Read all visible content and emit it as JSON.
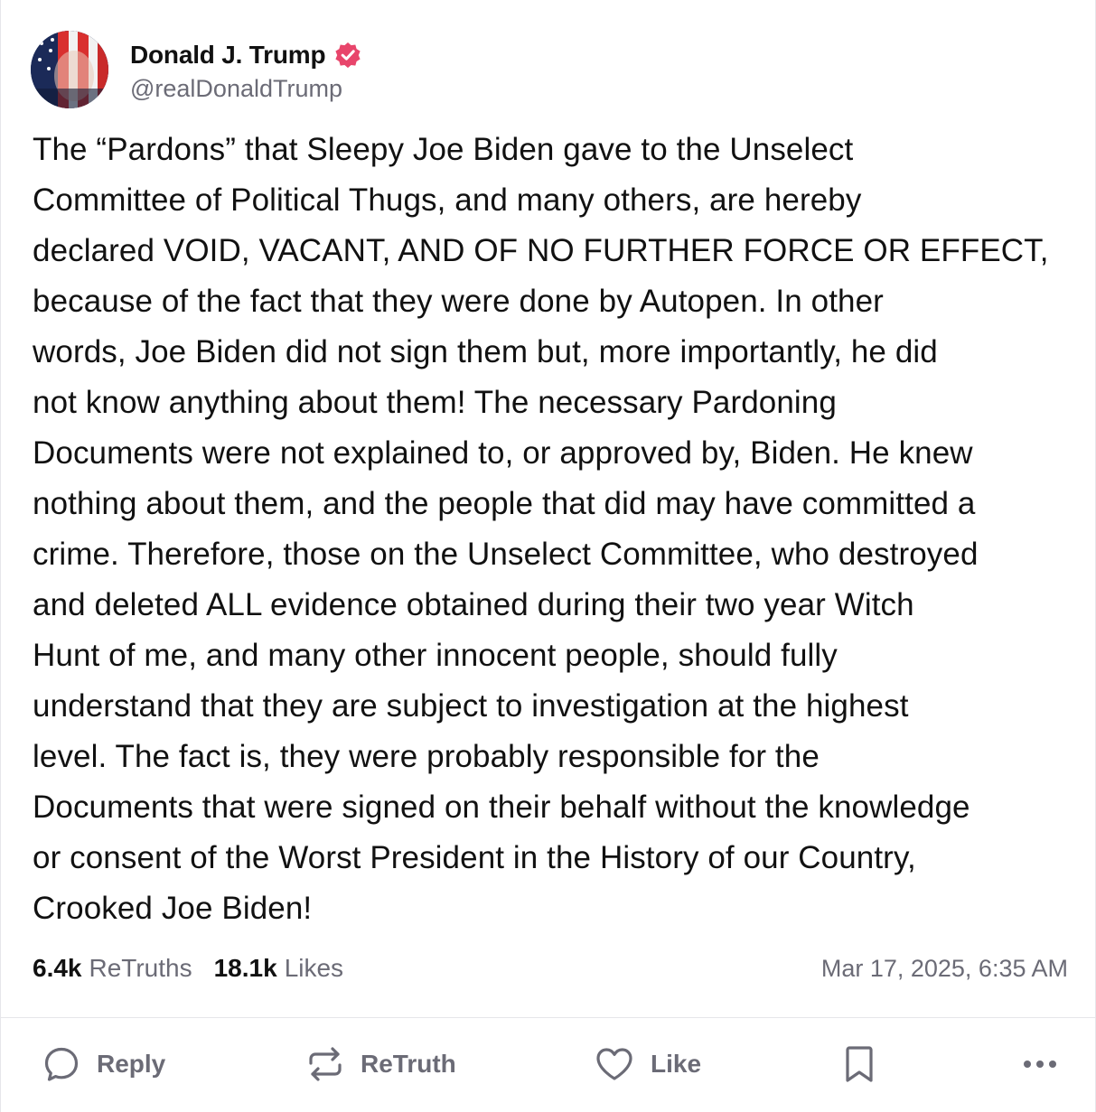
{
  "post": {
    "author": {
      "display_name": "Donald J. Trump",
      "handle": "@realDonaldTrump",
      "verified": true,
      "verified_badge_color": "#e8456b",
      "avatar_icon": "avatar-flag-portrait"
    },
    "text": "The “Pardons” that Sleepy Joe Biden gave to the Unselect\nCommittee of Political Thugs, and many others, are hereby\ndeclared VOID, VACANT, AND OF NO FURTHER FORCE OR EFFECT,\nbecause of the fact that they were done by Autopen. In other\nwords, Joe Biden did not sign them but, more importantly, he did\nnot know anything about them! The necessary Pardoning\nDocuments were not explained to, or approved by, Biden. He knew\nnothing about them, and the people that did may have committed a\ncrime. Therefore, those on the Unselect Committee, who destroyed\nand deleted ALL evidence obtained during their two year Witch\nHunt of me, and many other innocent people, should fully\nunderstand that they are subject to investigation at the highest\nlevel. The fact is, they were probably responsible for the\nDocuments that were signed on their behalf without the knowledge\nor consent of the Worst President in the History of our Country,\nCrooked Joe Biden!",
    "stats": {
      "retruths_count": "6.4k",
      "retruths_label": "ReTruths",
      "likes_count": "18.1k",
      "likes_label": "Likes"
    },
    "timestamp": "Mar 17, 2025, 6:35 AM"
  },
  "actions": {
    "reply_label": "Reply",
    "retruth_label": "ReTruth",
    "like_label": "Like",
    "bookmark_icon": "bookmark-icon",
    "more_icon": "more-options-icon"
  },
  "colors": {
    "text_primary": "#111111",
    "text_secondary": "#6b6b76",
    "divider": "#e6e6ea"
  }
}
